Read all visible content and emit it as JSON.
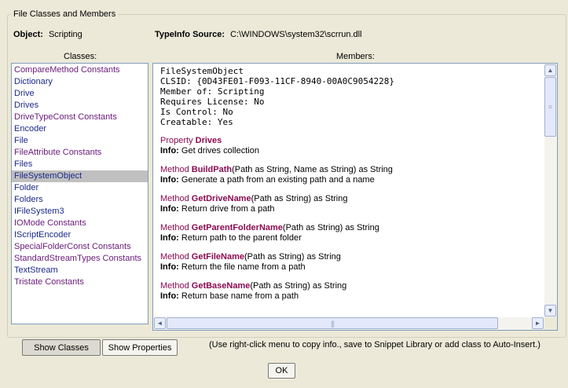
{
  "group": {
    "title": "File Classes and Members"
  },
  "object": {
    "label": "Object:",
    "value": "Scripting"
  },
  "typeinfo": {
    "label": "TypeInfo Source:",
    "value": "C:\\WINDOWS\\system32\\scrrun.dll"
  },
  "classes_header": "Classes:",
  "members_header": "Members:",
  "classes": [
    {
      "label": "CompareMethod Constants",
      "color": "#6a1a7a"
    },
    {
      "label": "Dictionary",
      "color": "#1a2a8a"
    },
    {
      "label": "Drive",
      "color": "#1a2a8a"
    },
    {
      "label": "Drives",
      "color": "#1a2a8a"
    },
    {
      "label": "DriveTypeConst Constants",
      "color": "#6a1a7a"
    },
    {
      "label": "Encoder",
      "color": "#1a2a8a"
    },
    {
      "label": "File",
      "color": "#1a2a8a"
    },
    {
      "label": "FileAttribute Constants",
      "color": "#6a1a7a"
    },
    {
      "label": "Files",
      "color": "#1a2a8a"
    },
    {
      "label": "FileSystemObject",
      "color": "#1a2a8a",
      "selected": true
    },
    {
      "label": "Folder",
      "color": "#1a2a8a"
    },
    {
      "label": "Folders",
      "color": "#1a2a8a"
    },
    {
      "label": "IFileSystem3",
      "color": "#1a2a8a"
    },
    {
      "label": "IOMode Constants",
      "color": "#6a1a7a"
    },
    {
      "label": "IScriptEncoder",
      "color": "#1a2a8a"
    },
    {
      "label": "SpecialFolderConst Constants",
      "color": "#6a1a7a"
    },
    {
      "label": "StandardStreamTypes Constants",
      "color": "#6a1a7a"
    },
    {
      "label": "TextStream",
      "color": "#1a2a8a"
    },
    {
      "label": "Tristate Constants",
      "color": "#6a1a7a"
    }
  ],
  "members": {
    "header_lines": [
      "FileSystemObject",
      "CLSID: {0D43FE01-F093-11CF-8940-00A0C9054228}",
      "Member of: Scripting",
      "Requires License: No",
      "Is Control: No",
      "Creatable: Yes"
    ],
    "items": [
      {
        "kind": "Property",
        "name": "Drives",
        "signature": "",
        "info_label": "Info:",
        "info": "Get drives collection"
      },
      {
        "kind": "Method",
        "name": "BuildPath",
        "signature": "(Path as String, Name as String) as String",
        "info_label": "Info:",
        "info": "Generate a path from an existing path and a name"
      },
      {
        "kind": "Method",
        "name": "GetDriveName",
        "signature": "(Path as String) as String",
        "info_label": "Info:",
        "info": "Return drive from a path"
      },
      {
        "kind": "Method",
        "name": "GetParentFolderName",
        "signature": "(Path as String) as String",
        "info_label": "Info:",
        "info": "Return path to the parent folder"
      },
      {
        "kind": "Method",
        "name": "GetFileName",
        "signature": "(Path as String) as String",
        "info_label": "Info:",
        "info": "Return the file name from a path"
      },
      {
        "kind": "Method",
        "name": "GetBaseName",
        "signature": "(Path as String) as String",
        "info_label": "Info:",
        "info": "Return base name from a path"
      }
    ]
  },
  "buttons": {
    "show_classes": "Show Classes",
    "show_properties": "Show Properties",
    "ok": "OK"
  },
  "hint": "(Use right-click menu to copy info., save to Snippet Library or add class to Auto-Insert.)",
  "icons": {
    "scroll_up": "▲",
    "scroll_down": "▼",
    "scroll_left": "◄",
    "scroll_right": "►",
    "grip": "≡"
  }
}
